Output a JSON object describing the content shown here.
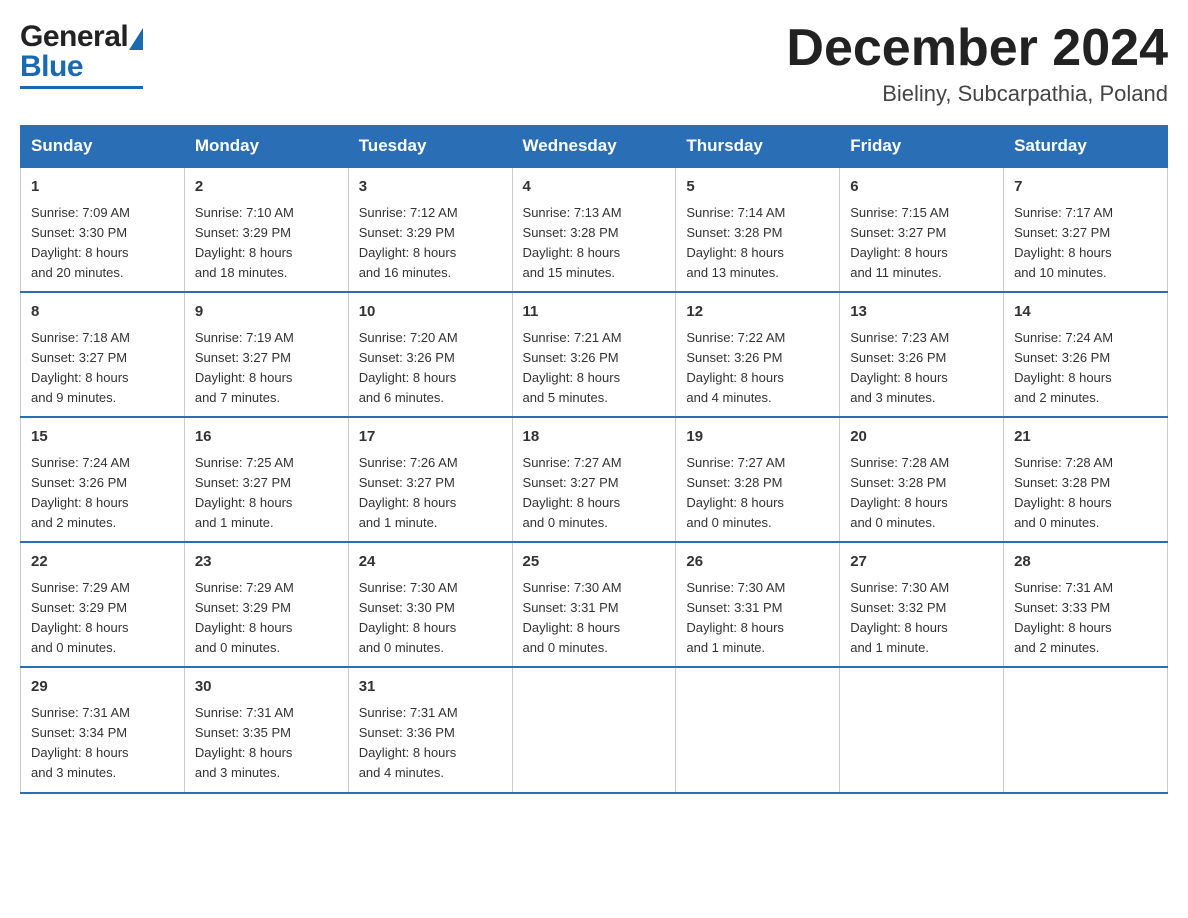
{
  "header": {
    "logo_general": "General",
    "logo_blue": "Blue",
    "month_title": "December 2024",
    "location": "Bieliny, Subcarpathia, Poland"
  },
  "calendar": {
    "days_of_week": [
      "Sunday",
      "Monday",
      "Tuesday",
      "Wednesday",
      "Thursday",
      "Friday",
      "Saturday"
    ],
    "weeks": [
      [
        {
          "day": "1",
          "sunrise": "7:09 AM",
          "sunset": "3:30 PM",
          "daylight": "8 hours and 20 minutes."
        },
        {
          "day": "2",
          "sunrise": "7:10 AM",
          "sunset": "3:29 PM",
          "daylight": "8 hours and 18 minutes."
        },
        {
          "day": "3",
          "sunrise": "7:12 AM",
          "sunset": "3:29 PM",
          "daylight": "8 hours and 16 minutes."
        },
        {
          "day": "4",
          "sunrise": "7:13 AM",
          "sunset": "3:28 PM",
          "daylight": "8 hours and 15 minutes."
        },
        {
          "day": "5",
          "sunrise": "7:14 AM",
          "sunset": "3:28 PM",
          "daylight": "8 hours and 13 minutes."
        },
        {
          "day": "6",
          "sunrise": "7:15 AM",
          "sunset": "3:27 PM",
          "daylight": "8 hours and 11 minutes."
        },
        {
          "day": "7",
          "sunrise": "7:17 AM",
          "sunset": "3:27 PM",
          "daylight": "8 hours and 10 minutes."
        }
      ],
      [
        {
          "day": "8",
          "sunrise": "7:18 AM",
          "sunset": "3:27 PM",
          "daylight": "8 hours and 9 minutes."
        },
        {
          "day": "9",
          "sunrise": "7:19 AM",
          "sunset": "3:27 PM",
          "daylight": "8 hours and 7 minutes."
        },
        {
          "day": "10",
          "sunrise": "7:20 AM",
          "sunset": "3:26 PM",
          "daylight": "8 hours and 6 minutes."
        },
        {
          "day": "11",
          "sunrise": "7:21 AM",
          "sunset": "3:26 PM",
          "daylight": "8 hours and 5 minutes."
        },
        {
          "day": "12",
          "sunrise": "7:22 AM",
          "sunset": "3:26 PM",
          "daylight": "8 hours and 4 minutes."
        },
        {
          "day": "13",
          "sunrise": "7:23 AM",
          "sunset": "3:26 PM",
          "daylight": "8 hours and 3 minutes."
        },
        {
          "day": "14",
          "sunrise": "7:24 AM",
          "sunset": "3:26 PM",
          "daylight": "8 hours and 2 minutes."
        }
      ],
      [
        {
          "day": "15",
          "sunrise": "7:24 AM",
          "sunset": "3:26 PM",
          "daylight": "8 hours and 2 minutes."
        },
        {
          "day": "16",
          "sunrise": "7:25 AM",
          "sunset": "3:27 PM",
          "daylight": "8 hours and 1 minute."
        },
        {
          "day": "17",
          "sunrise": "7:26 AM",
          "sunset": "3:27 PM",
          "daylight": "8 hours and 1 minute."
        },
        {
          "day": "18",
          "sunrise": "7:27 AM",
          "sunset": "3:27 PM",
          "daylight": "8 hours and 0 minutes."
        },
        {
          "day": "19",
          "sunrise": "7:27 AM",
          "sunset": "3:28 PM",
          "daylight": "8 hours and 0 minutes."
        },
        {
          "day": "20",
          "sunrise": "7:28 AM",
          "sunset": "3:28 PM",
          "daylight": "8 hours and 0 minutes."
        },
        {
          "day": "21",
          "sunrise": "7:28 AM",
          "sunset": "3:28 PM",
          "daylight": "8 hours and 0 minutes."
        }
      ],
      [
        {
          "day": "22",
          "sunrise": "7:29 AM",
          "sunset": "3:29 PM",
          "daylight": "8 hours and 0 minutes."
        },
        {
          "day": "23",
          "sunrise": "7:29 AM",
          "sunset": "3:29 PM",
          "daylight": "8 hours and 0 minutes."
        },
        {
          "day": "24",
          "sunrise": "7:30 AM",
          "sunset": "3:30 PM",
          "daylight": "8 hours and 0 minutes."
        },
        {
          "day": "25",
          "sunrise": "7:30 AM",
          "sunset": "3:31 PM",
          "daylight": "8 hours and 0 minutes."
        },
        {
          "day": "26",
          "sunrise": "7:30 AM",
          "sunset": "3:31 PM",
          "daylight": "8 hours and 1 minute."
        },
        {
          "day": "27",
          "sunrise": "7:30 AM",
          "sunset": "3:32 PM",
          "daylight": "8 hours and 1 minute."
        },
        {
          "day": "28",
          "sunrise": "7:31 AM",
          "sunset": "3:33 PM",
          "daylight": "8 hours and 2 minutes."
        }
      ],
      [
        {
          "day": "29",
          "sunrise": "7:31 AM",
          "sunset": "3:34 PM",
          "daylight": "8 hours and 3 minutes."
        },
        {
          "day": "30",
          "sunrise": "7:31 AM",
          "sunset": "3:35 PM",
          "daylight": "8 hours and 3 minutes."
        },
        {
          "day": "31",
          "sunrise": "7:31 AM",
          "sunset": "3:36 PM",
          "daylight": "8 hours and 4 minutes."
        },
        null,
        null,
        null,
        null
      ]
    ],
    "sunrise_label": "Sunrise:",
    "sunset_label": "Sunset:",
    "daylight_label": "Daylight:"
  }
}
